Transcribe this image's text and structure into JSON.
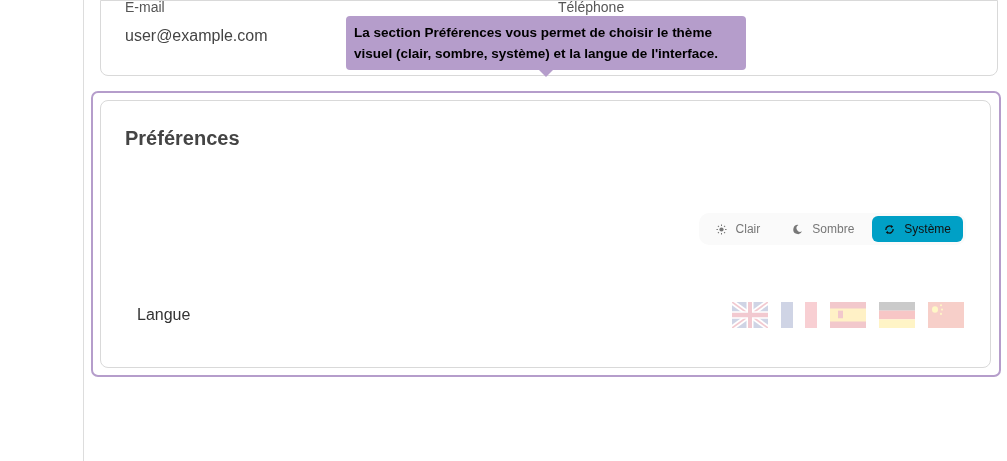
{
  "contact": {
    "fields": [
      {
        "label": "E-mail",
        "value": "user@example.com"
      },
      {
        "label": "Téléphone"
      }
    ]
  },
  "tooltip": {
    "text": "La section Préférences vous permet de choisir le thème visuel (clair, sombre, système) et la langue de l'interface."
  },
  "preferences": {
    "title": "Préférences",
    "theme_options": [
      {
        "label": "Clair",
        "kind": "sun",
        "selected": false
      },
      {
        "label": "Sombre",
        "kind": "moon",
        "selected": false
      },
      {
        "label": "Système",
        "kind": "sync",
        "selected": true
      }
    ],
    "language_label": "Langue",
    "languages": [
      {
        "kind": "gb",
        "selected": false
      },
      {
        "kind": "fr",
        "selected": false
      },
      {
        "kind": "es",
        "selected": false
      },
      {
        "kind": "de",
        "selected": false
      },
      {
        "kind": "cn",
        "selected": false
      }
    ]
  }
}
